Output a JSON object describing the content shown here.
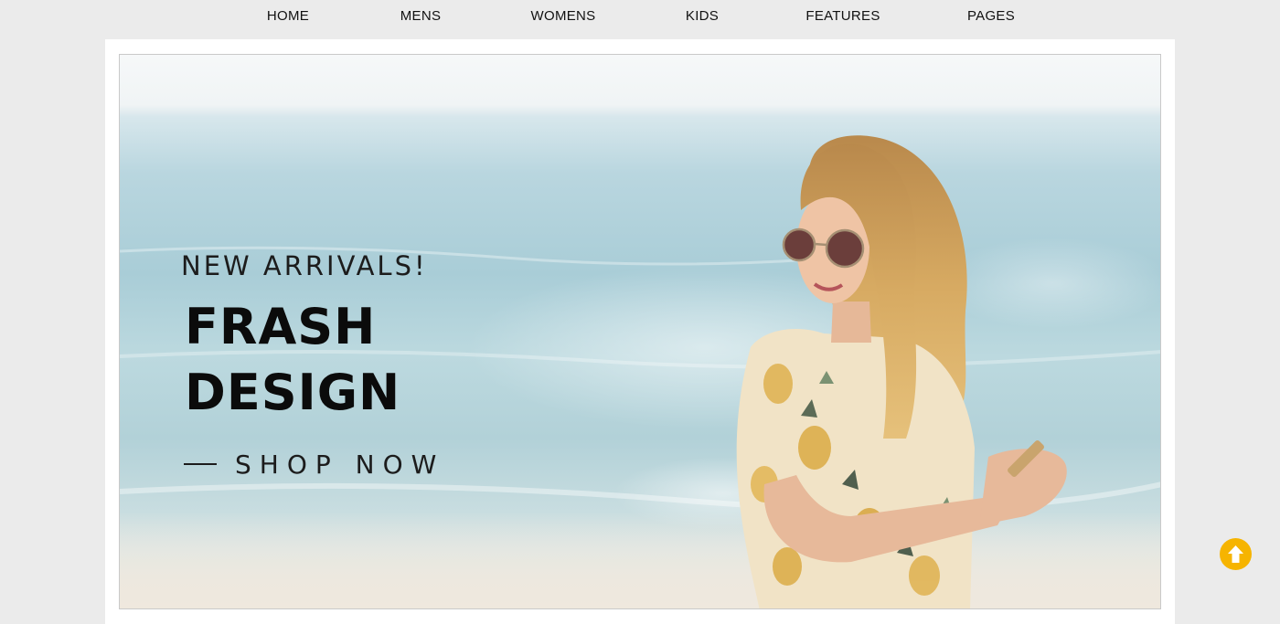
{
  "nav": {
    "items": [
      {
        "label": "HOME"
      },
      {
        "label": "MENS"
      },
      {
        "label": "WOMENS"
      },
      {
        "label": "KIDS"
      },
      {
        "label": "FEATURES"
      },
      {
        "label": "PAGES"
      }
    ]
  },
  "hero": {
    "kicker": "NEW ARRIVALS!",
    "title_line1": "FRASH",
    "title_line2": "DESIGN",
    "cta_label": "SHOP NOW",
    "image": "woman-on-beach-photo"
  },
  "scroll_top": {
    "icon": "arrow-up-circle-icon",
    "color": "#f6b400"
  }
}
